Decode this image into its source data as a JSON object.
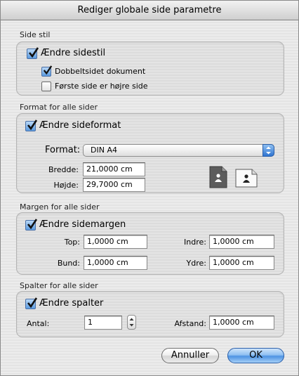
{
  "dialog": {
    "title": "Rediger globale side parametre"
  },
  "side_stil": {
    "section_label": "Side stil",
    "main_checkbox": {
      "label": "Ændre sidestil",
      "checked": true
    },
    "double_sided": {
      "label": "Dobbeltsidet dokument",
      "checked": true
    },
    "first_right": {
      "label": "Første side er højre side",
      "checked": false
    }
  },
  "format": {
    "section_label": "Format for alle sider",
    "main_checkbox": {
      "label": "Ændre sideformat",
      "checked": true
    },
    "format_label": "Format:",
    "format_value": "DIN A4",
    "width_label": "Bredde:",
    "width_value": "21,0000 cm",
    "height_label": "Højde:",
    "height_value": "29,7000 cm",
    "portrait_icon": "portrait-orientation-icon",
    "landscape_icon": "landscape-orientation-icon"
  },
  "margin": {
    "section_label": "Margen for alle sider",
    "main_checkbox": {
      "label": "Ændre sidemargen",
      "checked": true
    },
    "top_label": "Top:",
    "top_value": "1,0000 cm",
    "bottom_label": "Bund:",
    "bottom_value": "1,0000 cm",
    "inner_label": "Indre:",
    "inner_value": "1,0000 cm",
    "outer_label": "Ydre:",
    "outer_value": "1,0000 cm"
  },
  "columns": {
    "section_label": "Spalter for alle sider",
    "main_checkbox": {
      "label": "Ændre spalter",
      "checked": true
    },
    "count_label": "Antal:",
    "count_value": "1",
    "spacing_label": "Afstand:",
    "spacing_value": "1,0000 cm"
  },
  "buttons": {
    "cancel": "Annuller",
    "ok": "OK"
  },
  "colors": {
    "accent": "#3f86de",
    "window_bg": "#ececec"
  }
}
